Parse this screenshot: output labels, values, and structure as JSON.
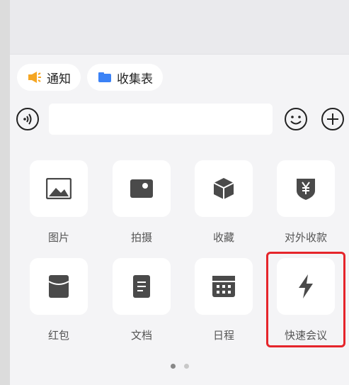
{
  "chips": [
    {
      "label": "通知",
      "icon": "megaphone-icon"
    },
    {
      "label": "收集表",
      "icon": "folder-icon"
    }
  ],
  "input": {
    "placeholder": "",
    "value": ""
  },
  "toolbar": {
    "voice_icon": "voice-icon",
    "emoji_icon": "emoji-icon",
    "plus_icon": "plus-icon"
  },
  "grid": [
    {
      "label": "图片",
      "icon": "image-icon"
    },
    {
      "label": "拍摄",
      "icon": "camera-icon"
    },
    {
      "label": "收藏",
      "icon": "favorites-cube-icon"
    },
    {
      "label": "对外收款",
      "icon": "yuan-shield-icon"
    },
    {
      "label": "红包",
      "icon": "red-packet-icon"
    },
    {
      "label": "文档",
      "icon": "document-icon"
    },
    {
      "label": "日程",
      "icon": "calendar-icon"
    },
    {
      "label": "快速会议",
      "icon": "lightning-icon"
    }
  ],
  "pagination": {
    "current": 1,
    "total": 2
  },
  "colors": {
    "accent_highlight": "#e5252b",
    "icon_gray": "#4a4a4a",
    "megaphone": "#f5a623",
    "folder": "#3b82f6"
  }
}
